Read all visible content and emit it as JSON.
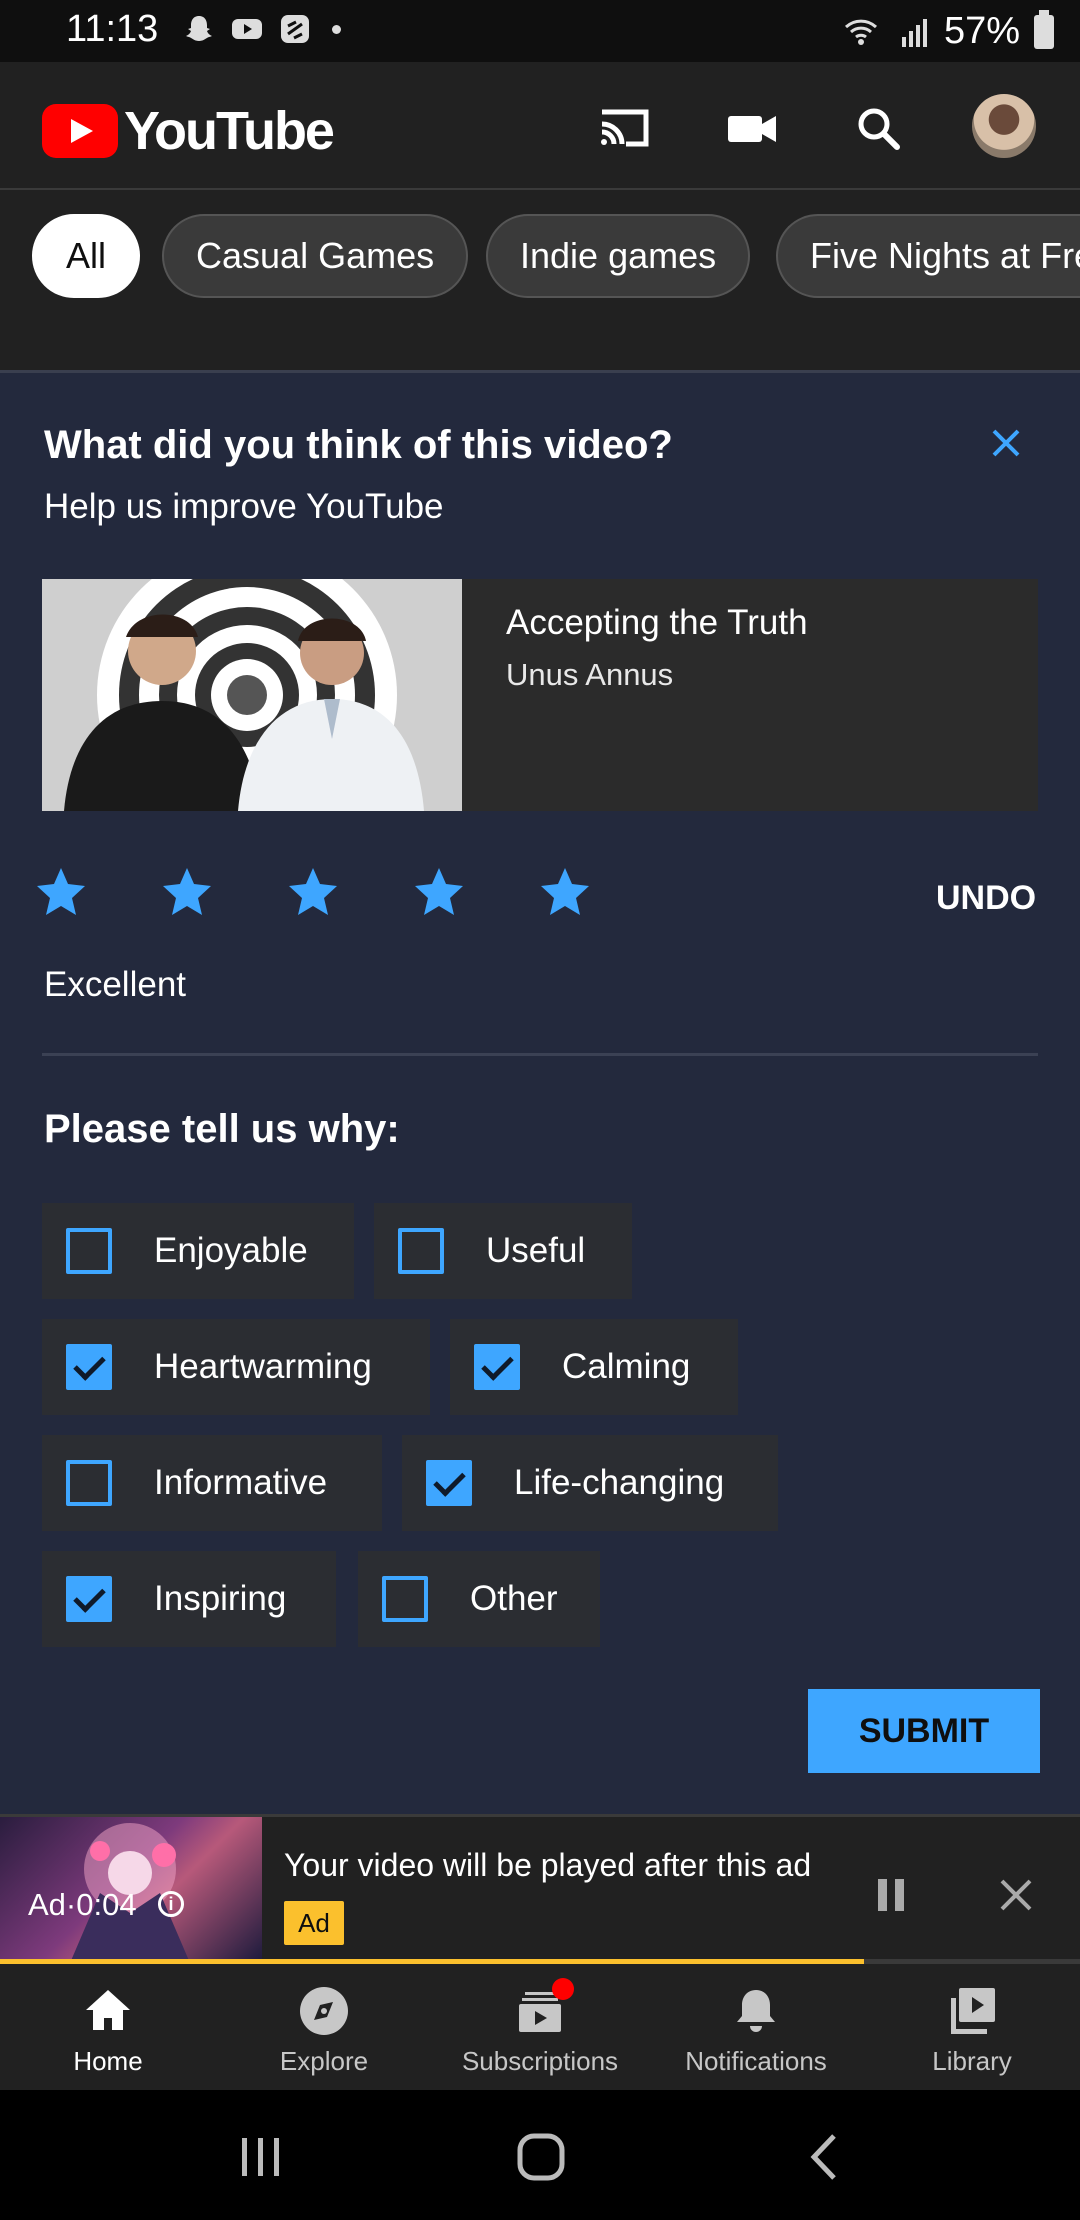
{
  "status_bar": {
    "time": "11:13",
    "battery": "57%"
  },
  "app": {
    "logo_text": "YouTube",
    "brand_color": "#ff0000"
  },
  "chips": [
    {
      "label": "All",
      "active": true
    },
    {
      "label": "Casual Games",
      "active": false
    },
    {
      "label": "Indie games",
      "active": false
    },
    {
      "label": "Five Nights at Fre",
      "active": false
    }
  ],
  "survey": {
    "question": "What did you think of this video?",
    "subtitle": "Help us improve YouTube",
    "video": {
      "title": "Accepting the Truth",
      "channel": "Unus Annus"
    },
    "rating": 5,
    "rating_max": 5,
    "undo_label": "UNDO",
    "rating_label": "Excellent",
    "why_heading": "Please tell us why:",
    "options": [
      {
        "label": "Enjoyable",
        "checked": false
      },
      {
        "label": "Useful",
        "checked": false
      },
      {
        "label": "Heartwarming",
        "checked": true
      },
      {
        "label": "Calming",
        "checked": true
      },
      {
        "label": "Informative",
        "checked": false
      },
      {
        "label": "Life-changing",
        "checked": true
      },
      {
        "label": "Inspiring",
        "checked": true
      },
      {
        "label": "Other",
        "checked": false
      }
    ],
    "submit_label": "SUBMIT",
    "accent_color": "#3ea6ff"
  },
  "ad": {
    "time": "Ad·0:04",
    "message": "Your video will be played after this ad",
    "badge": "Ad",
    "progress": 0.8,
    "progress_color": "#fbc02d"
  },
  "bottom_nav": [
    {
      "label": "Home",
      "icon": "home-icon",
      "active": true
    },
    {
      "label": "Explore",
      "icon": "compass-icon",
      "active": false
    },
    {
      "label": "Subscriptions",
      "icon": "subscriptions-icon",
      "active": false
    },
    {
      "label": "Notifications",
      "icon": "bell-icon",
      "active": false
    },
    {
      "label": "Library",
      "icon": "library-icon",
      "active": false
    }
  ]
}
